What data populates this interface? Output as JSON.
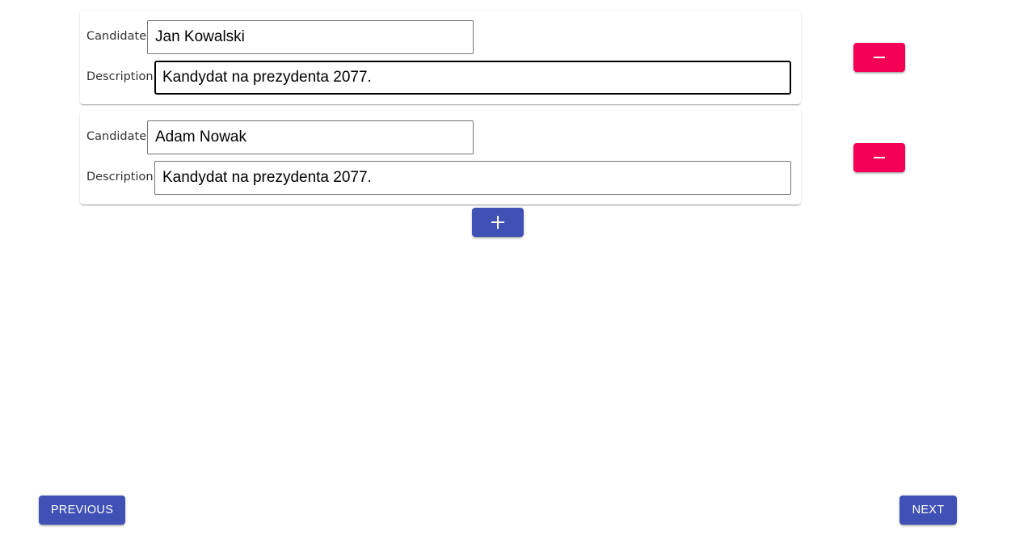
{
  "candidates": [
    {
      "candidate_label": "Candidate",
      "candidate_value": "Jan Kowalski",
      "description_label": "Description",
      "description_value": "Kandydat na prezydenta 2077.",
      "remove_icon": "minus-icon"
    },
    {
      "candidate_label": "Candidate",
      "candidate_value": "Adam Nowak",
      "description_label": "Description",
      "description_value": "Kandydat na prezydenta 2077.",
      "remove_icon": "minus-icon"
    }
  ],
  "add_button": {
    "icon": "plus-icon"
  },
  "navigation": {
    "previous_label": "PREVIOUS",
    "next_label": "NEXT"
  },
  "colors": {
    "primary": "#3f51b5",
    "secondary": "#f50057"
  }
}
